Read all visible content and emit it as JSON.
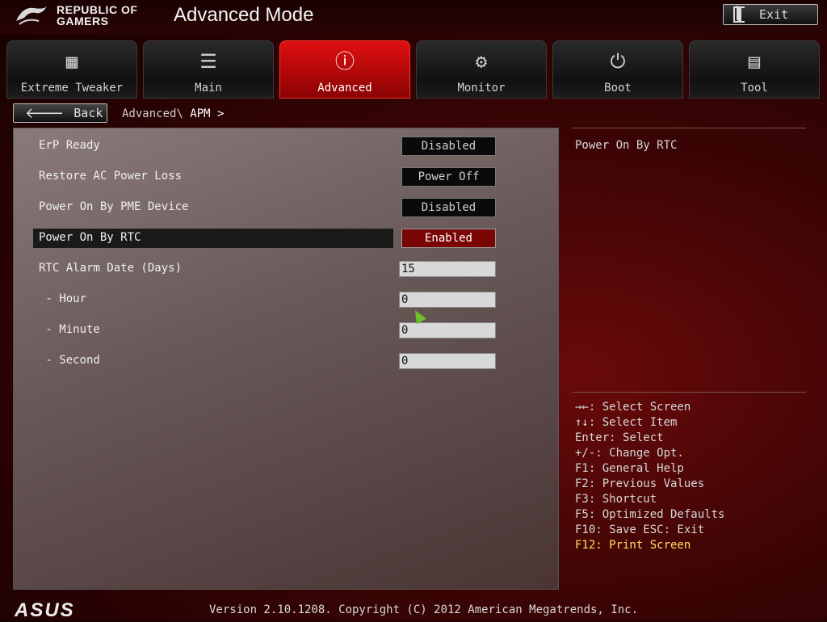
{
  "header": {
    "brand_line1": "REPUBLIC OF",
    "brand_line2": "GAMERS",
    "mode_title": "Advanced Mode",
    "exit_label": "Exit"
  },
  "tabs": [
    {
      "label": "Extreme Tweaker",
      "icon": "ai-chip-icon",
      "active": false
    },
    {
      "label": "Main",
      "icon": "list-icon",
      "active": false
    },
    {
      "label": "Advanced",
      "icon": "advanced-info-icon",
      "active": true
    },
    {
      "label": "Monitor",
      "icon": "monitor-gauge-icon",
      "active": false
    },
    {
      "label": "Boot",
      "icon": "power-icon",
      "active": false
    },
    {
      "label": "Tool",
      "icon": "toolbox-icon",
      "active": false
    }
  ],
  "nav": {
    "back_label": "Back",
    "breadcrumb_path": "Advanced\\",
    "breadcrumb_current": "APM",
    "breadcrumb_arrow": ">"
  },
  "settings": [
    {
      "name": "ErP Ready",
      "value": "Disabled",
      "kind": "select"
    },
    {
      "name": "Restore AC Power Loss",
      "value": "Power Off",
      "kind": "select"
    },
    {
      "name": "Power On By PME Device",
      "value": "Disabled",
      "kind": "select"
    },
    {
      "name": "Power On By RTC",
      "value": "Enabled",
      "kind": "select",
      "selected": true
    },
    {
      "name": "RTC Alarm Date (Days)",
      "value": "15",
      "kind": "input"
    },
    {
      "name": " - Hour",
      "value": "0",
      "kind": "input"
    },
    {
      "name": " - Minute",
      "value": "0",
      "kind": "input"
    },
    {
      "name": " - Second",
      "value": "0",
      "kind": "input"
    }
  ],
  "help": {
    "title": "Power On By RTC",
    "keys": [
      "→←: Select Screen",
      "↑↓: Select Item",
      "Enter: Select",
      "+/-: Change Opt.",
      "F1: General Help",
      "F2: Previous Values",
      "F3: Shortcut",
      "F5: Optimized Defaults",
      "F10: Save  ESC: Exit",
      "F12: Print Screen"
    ]
  },
  "footer": {
    "logo": "ASUS",
    "version": "Version 2.10.1208. Copyright (C) 2012 American Megatrends, Inc."
  },
  "colors": {
    "active_tab": "#d40808",
    "selected_value": "#7a0505",
    "hotkey": "#ffe060"
  }
}
